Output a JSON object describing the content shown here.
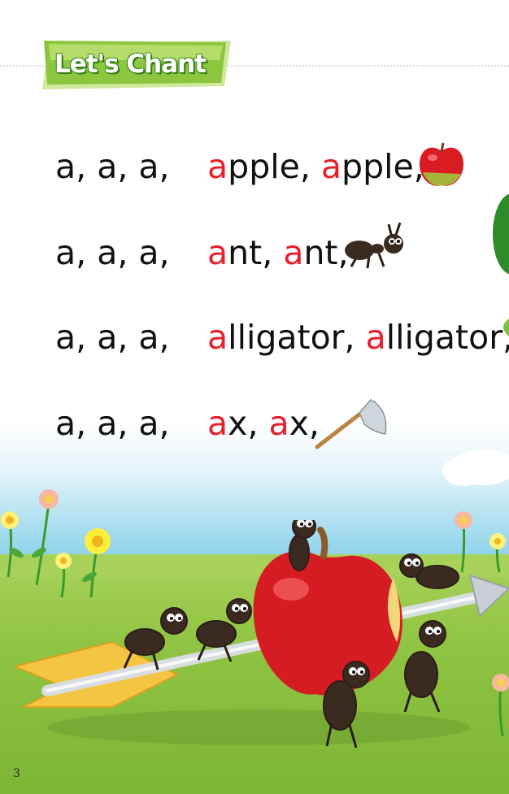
{
  "header": {
    "title": "Let's Chant"
  },
  "chant": {
    "lines": [
      {
        "lead": "a, a, a,",
        "w1_first": "a",
        "w1_rest": "pple",
        "sep": ", ",
        "w2_first": "a",
        "w2_rest": "pple",
        "end": ",",
        "picture": "apple-icon"
      },
      {
        "lead": "a, a, a,",
        "w1_first": "a",
        "w1_rest": "nt",
        "sep": ", ",
        "w2_first": "a",
        "w2_rest": "nt",
        "end": ",",
        "picture": "ant-icon"
      },
      {
        "lead": "a, a, a,",
        "w1_first": "a",
        "w1_rest": "lligator",
        "sep": ", ",
        "w2_first": "a",
        "w2_rest": "lligator",
        "end": ",",
        "picture": "alligator-icon"
      },
      {
        "lead": "a, a, a,",
        "w1_first": "a",
        "w1_rest": "x",
        "sep": ", ",
        "w2_first": "a",
        "w2_rest": "x",
        "end": ",",
        "picture": "ax-icon"
      }
    ]
  },
  "footer": {
    "page_number": "3"
  },
  "colors": {
    "highlight": "#e8202a",
    "banner": "#8cc63f",
    "text": "#111111"
  }
}
